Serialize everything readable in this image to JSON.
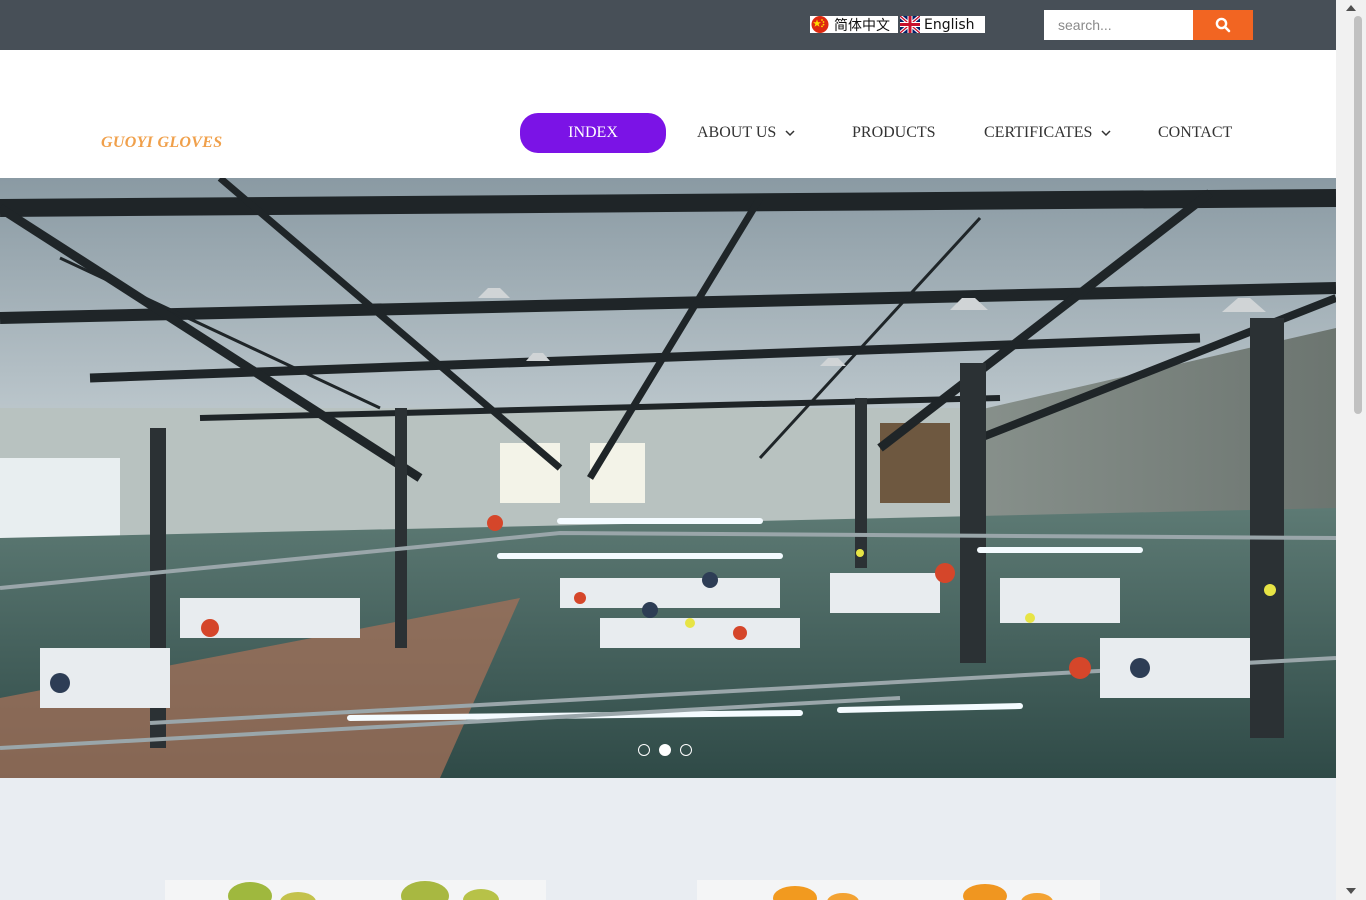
{
  "topbar": {
    "languages": [
      {
        "label": "简体中文",
        "icon": "china-flag-icon"
      },
      {
        "label": "English",
        "icon": "uk-flag-icon"
      }
    ],
    "search": {
      "placeholder": "search...",
      "value": "",
      "button_icon": "search-icon"
    }
  },
  "header": {
    "logo_text": "GUOYI GLOVES",
    "nav": [
      {
        "label": "INDEX",
        "active": true
      },
      {
        "label": "ABOUT US",
        "dropdown": true,
        "icon": "chevron-down-icon"
      },
      {
        "label": "PRODUCTS"
      },
      {
        "label": "CERTIFICATES",
        "dropdown": true,
        "icon": "chevron-down-icon"
      },
      {
        "label": "CONTACT"
      }
    ]
  },
  "hero": {
    "image_subject": "glove factory workshop interior",
    "slides_total": 3,
    "active_slide": 2
  },
  "colors": {
    "topbar_bg": "#474f57",
    "search_button": "#f26522",
    "nav_active": "#7b13e6",
    "logo": "#f0a04b",
    "lower_bg": "#e9edf2"
  }
}
